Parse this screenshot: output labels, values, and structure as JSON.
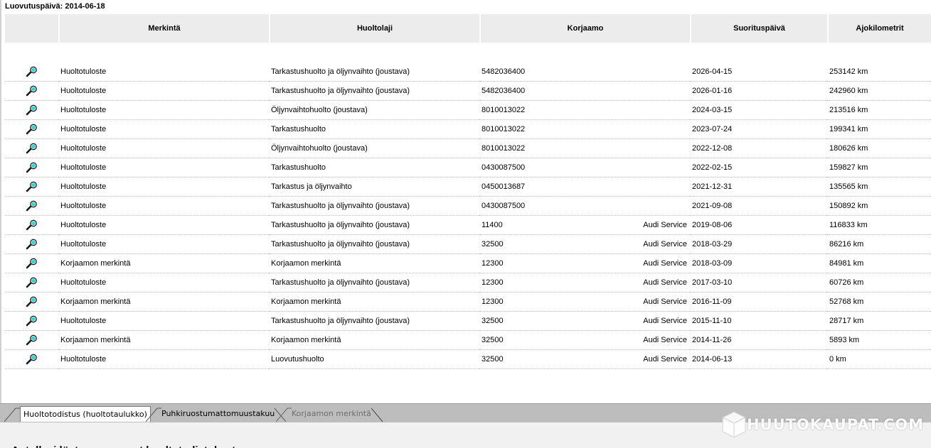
{
  "delivery_date_label": "Luovutuspäivä: 2014-06-18",
  "columns": {
    "merkinta": "Merkintä",
    "huoltolaji": "Huoltolaji",
    "korjaamo": "Korjaamo",
    "suorituspaiva": "Suorituspäivä",
    "ajokilometrit": "Ajokilometrit"
  },
  "rows": [
    {
      "merkinta": "Huoltotuloste",
      "huoltolaji": "Tarkastushuolto ja öljynvaihto (joustava)",
      "korjaamo_code": "5482036400",
      "korjaamo_name": "",
      "date": "2026-04-15",
      "km": "253142 km"
    },
    {
      "merkinta": "Huoltotuloste",
      "huoltolaji": "Tarkastushuolto ja öljynvaihto (joustava)",
      "korjaamo_code": "5482036400",
      "korjaamo_name": "",
      "date": "2026-01-16",
      "km": "242960 km"
    },
    {
      "merkinta": "Huoltotuloste",
      "huoltolaji": "Öljynvaihtohuolto (joustava)",
      "korjaamo_code": "8010013022",
      "korjaamo_name": "",
      "date": "2024-03-15",
      "km": "213516 km"
    },
    {
      "merkinta": "Huoltotuloste",
      "huoltolaji": "Tarkastushuolto",
      "korjaamo_code": "8010013022",
      "korjaamo_name": "",
      "date": "2023-07-24",
      "km": "199341 km"
    },
    {
      "merkinta": "Huoltotuloste",
      "huoltolaji": "Öljynvaihtohuolto (joustava)",
      "korjaamo_code": "8010013022",
      "korjaamo_name": "",
      "date": "2022-12-08",
      "km": "180626 km"
    },
    {
      "merkinta": "Huoltotuloste",
      "huoltolaji": "Tarkastushuolto",
      "korjaamo_code": "0430087500",
      "korjaamo_name": "",
      "date": "2022-02-15",
      "km": "159827 km"
    },
    {
      "merkinta": "Huoltotuloste",
      "huoltolaji": "Tarkastus ja öljynvaihto",
      "korjaamo_code": "0450013687",
      "korjaamo_name": "",
      "date": "2021-12-31",
      "km": "135565 km"
    },
    {
      "merkinta": "Huoltotuloste",
      "huoltolaji": "Tarkastushuolto ja öljynvaihto (joustava)",
      "korjaamo_code": "0430087500",
      "korjaamo_name": "",
      "date": "2021-09-08",
      "km": "150892 km"
    },
    {
      "merkinta": "Huoltotuloste",
      "huoltolaji": "Tarkastushuolto ja öljynvaihto (joustava)",
      "korjaamo_code": "11400",
      "korjaamo_name": "Audi Service",
      "date": "2019-08-06",
      "km": "116833 km"
    },
    {
      "merkinta": "Huoltotuloste",
      "huoltolaji": "Tarkastushuolto ja öljynvaihto (joustava)",
      "korjaamo_code": "32500",
      "korjaamo_name": "Audi Service",
      "date": "2018-03-29",
      "km": "86216 km"
    },
    {
      "merkinta": "Korjaamon merkintä",
      "huoltolaji": "Korjaamon merkintä",
      "korjaamo_code": "12300",
      "korjaamo_name": "Audi Service",
      "date": "2018-03-09",
      "km": "84981 km"
    },
    {
      "merkinta": "Huoltotuloste",
      "huoltolaji": "Tarkastushuolto ja öljynvaihto (joustava)",
      "korjaamo_code": "12300",
      "korjaamo_name": "Audi Service",
      "date": "2017-03-10",
      "km": "60726 km"
    },
    {
      "merkinta": "Korjaamon merkintä",
      "huoltolaji": "Korjaamon merkintä",
      "korjaamo_code": "12300",
      "korjaamo_name": "Audi Service",
      "date": "2016-11-09",
      "km": "52768 km"
    },
    {
      "merkinta": "Huoltotuloste",
      "huoltolaji": "Tarkastushuolto ja öljynvaihto (joustava)",
      "korjaamo_code": "32500",
      "korjaamo_name": "Audi Service",
      "date": "2015-11-10",
      "km": "28717 km"
    },
    {
      "merkinta": "Korjaamon merkintä",
      "huoltolaji": "Korjaamon merkintä",
      "korjaamo_code": "32500",
      "korjaamo_name": "Audi Service",
      "date": "2014-11-26",
      "km": "5893 km"
    },
    {
      "merkinta": "Huoltotuloste",
      "huoltolaji": "Luovutushuolto",
      "korjaamo_code": "32500",
      "korjaamo_name": "Audi Service",
      "date": "2014-06-13",
      "km": "0 km"
    }
  ],
  "tabs": [
    {
      "label": "Huoltotodistus (huoltotaulukko)",
      "state": "active"
    },
    {
      "label": "Puhkiruostumattomuustakuu",
      "state": "normal"
    },
    {
      "label": "Korjaamon merkintä",
      "state": "disabled"
    }
  ],
  "bottom_heading": "Autollasi löytyy seuraavat huoltotodistukset",
  "watermark": "HUUTOKAUPAT.COM",
  "icons": {
    "row_action": "magnifier-icon"
  },
  "colors": {
    "header_bg": "#ececec",
    "tabbar_bg": "#bdbdbd",
    "magnifier_lens": "#2ad6d0"
  }
}
